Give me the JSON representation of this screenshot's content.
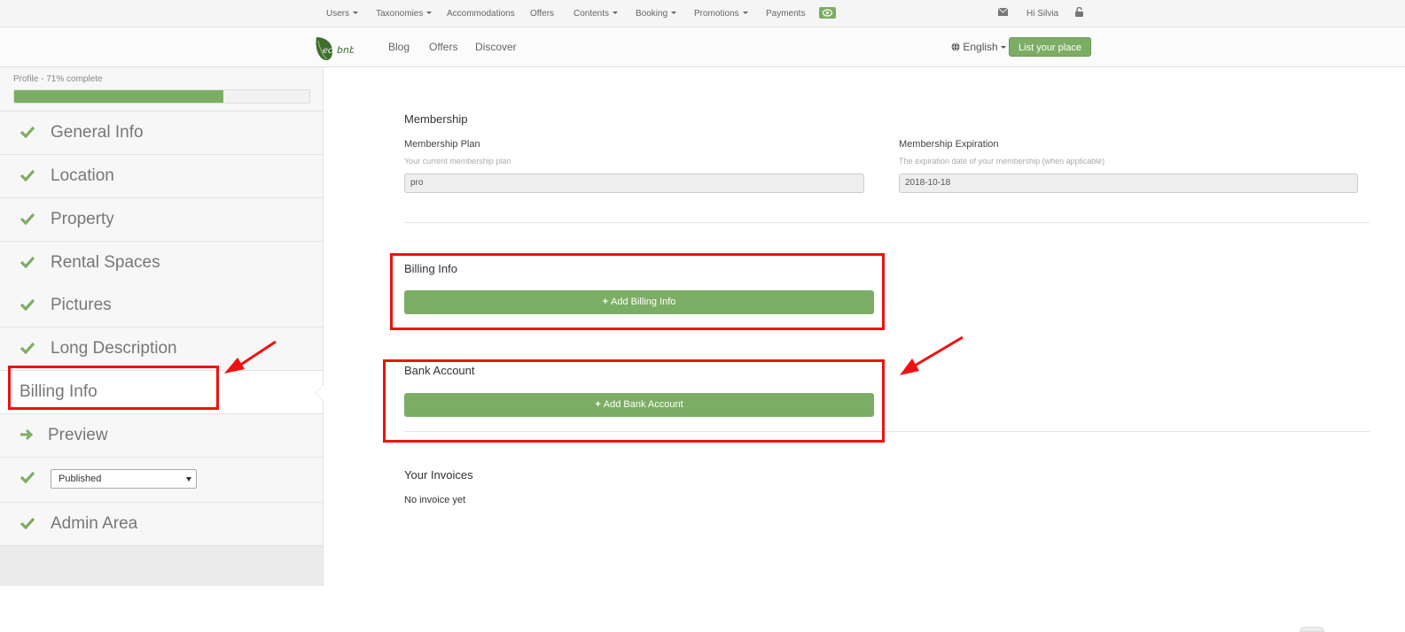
{
  "adminbar": {
    "items": [
      {
        "label": "Users",
        "dropdown": true
      },
      {
        "label": "Taxonomies",
        "dropdown": true
      },
      {
        "label": "Accommodations",
        "dropdown": false
      },
      {
        "label": "Offers",
        "dropdown": false
      },
      {
        "label": "Contents",
        "dropdown": true
      },
      {
        "label": "Booking",
        "dropdown": true
      },
      {
        "label": "Promotions",
        "dropdown": true
      },
      {
        "label": "Payments",
        "dropdown": false
      }
    ],
    "preview_icon": "eye-icon",
    "mail_icon": "envelope-icon",
    "greeting": "Hi Silvia",
    "logout_icon": "unlock-icon"
  },
  "header": {
    "logo_icon": "leaf-icon",
    "logo_text": "eco bnb",
    "nav": [
      "Blog",
      "Offers",
      "Discover"
    ],
    "language": "English",
    "language_icon": "globe-icon",
    "cta": "List your place"
  },
  "sidebar": {
    "profile_label": "Profile - 71% complete",
    "profile_progress": 0.71,
    "items": [
      {
        "label": "General Info",
        "icon": "check-icon"
      },
      {
        "label": "Location",
        "icon": "check-icon"
      },
      {
        "label": "Property",
        "icon": "check-icon"
      },
      {
        "label": "Rental Spaces",
        "icon": "check-icon"
      },
      {
        "label": "Pictures",
        "icon": "check-icon"
      },
      {
        "label": "Long Description",
        "icon": "check-icon"
      },
      {
        "label": "Billing Info",
        "icon": "",
        "active": true
      },
      {
        "label": "Preview",
        "icon": "arrow-right-icon"
      },
      {
        "label": "",
        "icon": "check-icon"
      },
      {
        "label": "Admin Area",
        "icon": "check-icon"
      }
    ],
    "status_select": {
      "value": "Published"
    }
  },
  "main": {
    "membership": {
      "title": "Membership",
      "plan_label": "Membership Plan",
      "plan_help": "Your current membership plan",
      "plan_value": "pro",
      "expiration_label": "Membership Expiration",
      "expiration_help": "The expiration date of your membership (when applicable)",
      "expiration_value": "2018-10-18"
    },
    "billing": {
      "title": "Billing Info",
      "button": "Add Billing Info"
    },
    "bank": {
      "title": "Bank Account",
      "button": "Add Bank Account"
    },
    "invoices": {
      "title": "Your Invoices",
      "empty": "No invoice yet"
    }
  },
  "colors": {
    "accent": "#7cad64",
    "annotation": "#ee1111"
  }
}
